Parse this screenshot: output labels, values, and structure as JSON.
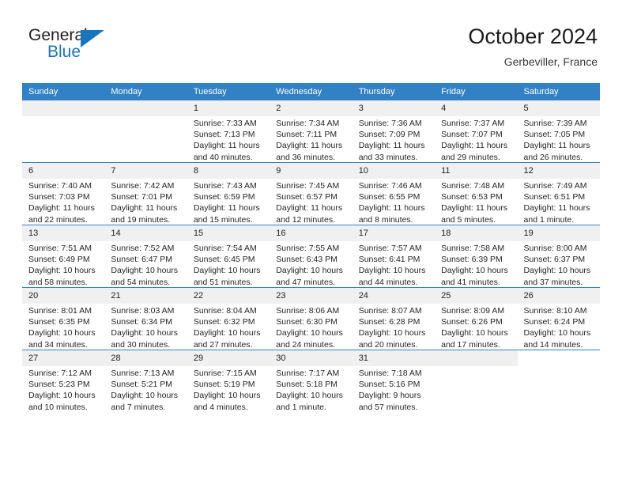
{
  "brand": {
    "name_top": "General",
    "name_bottom": "Blue",
    "color_primary": "#1b75bb",
    "color_text": "#231f20"
  },
  "header": {
    "title": "October 2024",
    "location": "Gerbeviller, France"
  },
  "theme": {
    "header_row_bg": "#3281c4",
    "daynum_bg": "#f0f0f0",
    "grid_line": "#3281c4"
  },
  "weekday_headers": [
    "Sunday",
    "Monday",
    "Tuesday",
    "Wednesday",
    "Thursday",
    "Friday",
    "Saturday"
  ],
  "labels": {
    "sunrise_prefix": "Sunrise:",
    "sunset_prefix": "Sunset:",
    "daylight_prefix": "Daylight:"
  },
  "weeks": [
    [
      {
        "day": "",
        "sunrise": "",
        "sunset": "",
        "daylight_line1": "",
        "daylight_line2": "",
        "blank": true
      },
      {
        "day": "",
        "sunrise": "",
        "sunset": "",
        "daylight_line1": "",
        "daylight_line2": "",
        "blank": true
      },
      {
        "day": "1",
        "sunrise": "Sunrise: 7:33 AM",
        "sunset": "Sunset: 7:13 PM",
        "daylight_line1": "Daylight: 11 hours",
        "daylight_line2": "and 40 minutes."
      },
      {
        "day": "2",
        "sunrise": "Sunrise: 7:34 AM",
        "sunset": "Sunset: 7:11 PM",
        "daylight_line1": "Daylight: 11 hours",
        "daylight_line2": "and 36 minutes."
      },
      {
        "day": "3",
        "sunrise": "Sunrise: 7:36 AM",
        "sunset": "Sunset: 7:09 PM",
        "daylight_line1": "Daylight: 11 hours",
        "daylight_line2": "and 33 minutes."
      },
      {
        "day": "4",
        "sunrise": "Sunrise: 7:37 AM",
        "sunset": "Sunset: 7:07 PM",
        "daylight_line1": "Daylight: 11 hours",
        "daylight_line2": "and 29 minutes."
      },
      {
        "day": "5",
        "sunrise": "Sunrise: 7:39 AM",
        "sunset": "Sunset: 7:05 PM",
        "daylight_line1": "Daylight: 11 hours",
        "daylight_line2": "and 26 minutes."
      }
    ],
    [
      {
        "day": "6",
        "sunrise": "Sunrise: 7:40 AM",
        "sunset": "Sunset: 7:03 PM",
        "daylight_line1": "Daylight: 11 hours",
        "daylight_line2": "and 22 minutes."
      },
      {
        "day": "7",
        "sunrise": "Sunrise: 7:42 AM",
        "sunset": "Sunset: 7:01 PM",
        "daylight_line1": "Daylight: 11 hours",
        "daylight_line2": "and 19 minutes."
      },
      {
        "day": "8",
        "sunrise": "Sunrise: 7:43 AM",
        "sunset": "Sunset: 6:59 PM",
        "daylight_line1": "Daylight: 11 hours",
        "daylight_line2": "and 15 minutes."
      },
      {
        "day": "9",
        "sunrise": "Sunrise: 7:45 AM",
        "sunset": "Sunset: 6:57 PM",
        "daylight_line1": "Daylight: 11 hours",
        "daylight_line2": "and 12 minutes."
      },
      {
        "day": "10",
        "sunrise": "Sunrise: 7:46 AM",
        "sunset": "Sunset: 6:55 PM",
        "daylight_line1": "Daylight: 11 hours",
        "daylight_line2": "and 8 minutes."
      },
      {
        "day": "11",
        "sunrise": "Sunrise: 7:48 AM",
        "sunset": "Sunset: 6:53 PM",
        "daylight_line1": "Daylight: 11 hours",
        "daylight_line2": "and 5 minutes."
      },
      {
        "day": "12",
        "sunrise": "Sunrise: 7:49 AM",
        "sunset": "Sunset: 6:51 PM",
        "daylight_line1": "Daylight: 11 hours",
        "daylight_line2": "and 1 minute."
      }
    ],
    [
      {
        "day": "13",
        "sunrise": "Sunrise: 7:51 AM",
        "sunset": "Sunset: 6:49 PM",
        "daylight_line1": "Daylight: 10 hours",
        "daylight_line2": "and 58 minutes."
      },
      {
        "day": "14",
        "sunrise": "Sunrise: 7:52 AM",
        "sunset": "Sunset: 6:47 PM",
        "daylight_line1": "Daylight: 10 hours",
        "daylight_line2": "and 54 minutes."
      },
      {
        "day": "15",
        "sunrise": "Sunrise: 7:54 AM",
        "sunset": "Sunset: 6:45 PM",
        "daylight_line1": "Daylight: 10 hours",
        "daylight_line2": "and 51 minutes."
      },
      {
        "day": "16",
        "sunrise": "Sunrise: 7:55 AM",
        "sunset": "Sunset: 6:43 PM",
        "daylight_line1": "Daylight: 10 hours",
        "daylight_line2": "and 47 minutes."
      },
      {
        "day": "17",
        "sunrise": "Sunrise: 7:57 AM",
        "sunset": "Sunset: 6:41 PM",
        "daylight_line1": "Daylight: 10 hours",
        "daylight_line2": "and 44 minutes."
      },
      {
        "day": "18",
        "sunrise": "Sunrise: 7:58 AM",
        "sunset": "Sunset: 6:39 PM",
        "daylight_line1": "Daylight: 10 hours",
        "daylight_line2": "and 41 minutes."
      },
      {
        "day": "19",
        "sunrise": "Sunrise: 8:00 AM",
        "sunset": "Sunset: 6:37 PM",
        "daylight_line1": "Daylight: 10 hours",
        "daylight_line2": "and 37 minutes."
      }
    ],
    [
      {
        "day": "20",
        "sunrise": "Sunrise: 8:01 AM",
        "sunset": "Sunset: 6:35 PM",
        "daylight_line1": "Daylight: 10 hours",
        "daylight_line2": "and 34 minutes."
      },
      {
        "day": "21",
        "sunrise": "Sunrise: 8:03 AM",
        "sunset": "Sunset: 6:34 PM",
        "daylight_line1": "Daylight: 10 hours",
        "daylight_line2": "and 30 minutes."
      },
      {
        "day": "22",
        "sunrise": "Sunrise: 8:04 AM",
        "sunset": "Sunset: 6:32 PM",
        "daylight_line1": "Daylight: 10 hours",
        "daylight_line2": "and 27 minutes."
      },
      {
        "day": "23",
        "sunrise": "Sunrise: 8:06 AM",
        "sunset": "Sunset: 6:30 PM",
        "daylight_line1": "Daylight: 10 hours",
        "daylight_line2": "and 24 minutes."
      },
      {
        "day": "24",
        "sunrise": "Sunrise: 8:07 AM",
        "sunset": "Sunset: 6:28 PM",
        "daylight_line1": "Daylight: 10 hours",
        "daylight_line2": "and 20 minutes."
      },
      {
        "day": "25",
        "sunrise": "Sunrise: 8:09 AM",
        "sunset": "Sunset: 6:26 PM",
        "daylight_line1": "Daylight: 10 hours",
        "daylight_line2": "and 17 minutes."
      },
      {
        "day": "26",
        "sunrise": "Sunrise: 8:10 AM",
        "sunset": "Sunset: 6:24 PM",
        "daylight_line1": "Daylight: 10 hours",
        "daylight_line2": "and 14 minutes."
      }
    ],
    [
      {
        "day": "27",
        "sunrise": "Sunrise: 7:12 AM",
        "sunset": "Sunset: 5:23 PM",
        "daylight_line1": "Daylight: 10 hours",
        "daylight_line2": "and 10 minutes."
      },
      {
        "day": "28",
        "sunrise": "Sunrise: 7:13 AM",
        "sunset": "Sunset: 5:21 PM",
        "daylight_line1": "Daylight: 10 hours",
        "daylight_line2": "and 7 minutes."
      },
      {
        "day": "29",
        "sunrise": "Sunrise: 7:15 AM",
        "sunset": "Sunset: 5:19 PM",
        "daylight_line1": "Daylight: 10 hours",
        "daylight_line2": "and 4 minutes."
      },
      {
        "day": "30",
        "sunrise": "Sunrise: 7:17 AM",
        "sunset": "Sunset: 5:18 PM",
        "daylight_line1": "Daylight: 10 hours",
        "daylight_line2": "and 1 minute."
      },
      {
        "day": "31",
        "sunrise": "Sunrise: 7:18 AM",
        "sunset": "Sunset: 5:16 PM",
        "daylight_line1": "Daylight: 9 hours",
        "daylight_line2": "and 57 minutes."
      },
      {
        "day": "",
        "sunrise": "",
        "sunset": "",
        "daylight_line1": "",
        "daylight_line2": "",
        "blank": true
      },
      {
        "day": "",
        "sunrise": "",
        "sunset": "",
        "daylight_line1": "",
        "daylight_line2": "",
        "nofill": true
      }
    ]
  ]
}
